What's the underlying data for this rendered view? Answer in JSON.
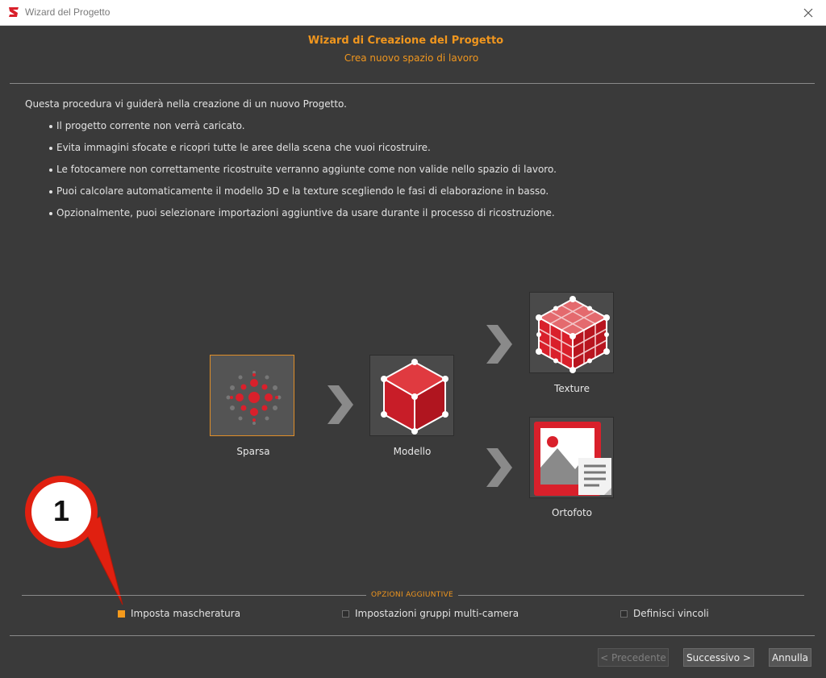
{
  "window": {
    "title": "Wizard del Progetto",
    "icon": "app-logo-icon",
    "close_icon": "close-icon"
  },
  "header": {
    "title": "Wizard di Creazione del Progetto",
    "subtitle": "Crea nuovo spazio di lavoro"
  },
  "intro": "Questa procedura vi guiderà nella creazione di un nuovo Progetto.",
  "bullets": [
    "Il progetto corrente non verrà caricato.",
    "Evita immagini sfocate e ricopri tutte le aree della scena che vuoi ricostruire.",
    "Le fotocamere non correttamente ricostruite verranno aggiunte come non valide nello spazio di lavoro.",
    "Puoi calcolare automaticamente il modello 3D e la texture scegliendo le fasi di elaborazione in basso.",
    "Opzionalmente, puoi selezionare importazioni aggiuntive da usare durante il processo di ricostruzione."
  ],
  "stages": {
    "sparsa": {
      "label": "Sparsa",
      "icon": "sparse-point-cloud-icon",
      "selected": true
    },
    "modello": {
      "label": "Modello",
      "icon": "mesh-cube-icon",
      "selected": false
    },
    "texture": {
      "label": "Texture",
      "icon": "textured-cube-icon",
      "selected": false
    },
    "ortofoto": {
      "label": "Ortofoto",
      "icon": "orthophoto-icon",
      "selected": false
    }
  },
  "callout": {
    "number": "1",
    "icon": "numbered-callout-pointer"
  },
  "options": {
    "legend": "OPZIONI AGGIUNTIVE",
    "items": [
      {
        "label": "Imposta mascheratura",
        "checked": true
      },
      {
        "label": "Impostazioni gruppi multi-camera",
        "checked": false
      },
      {
        "label": "Definisci vincoli",
        "checked": false
      }
    ]
  },
  "buttons": {
    "prev": "< Precedente",
    "next": "Successivo >",
    "cancel": "Annulla"
  },
  "colors": {
    "accent": "#f0961e",
    "background": "#3a3a3a",
    "icon_red": "#d9202b",
    "callout_red": "#e02010"
  }
}
